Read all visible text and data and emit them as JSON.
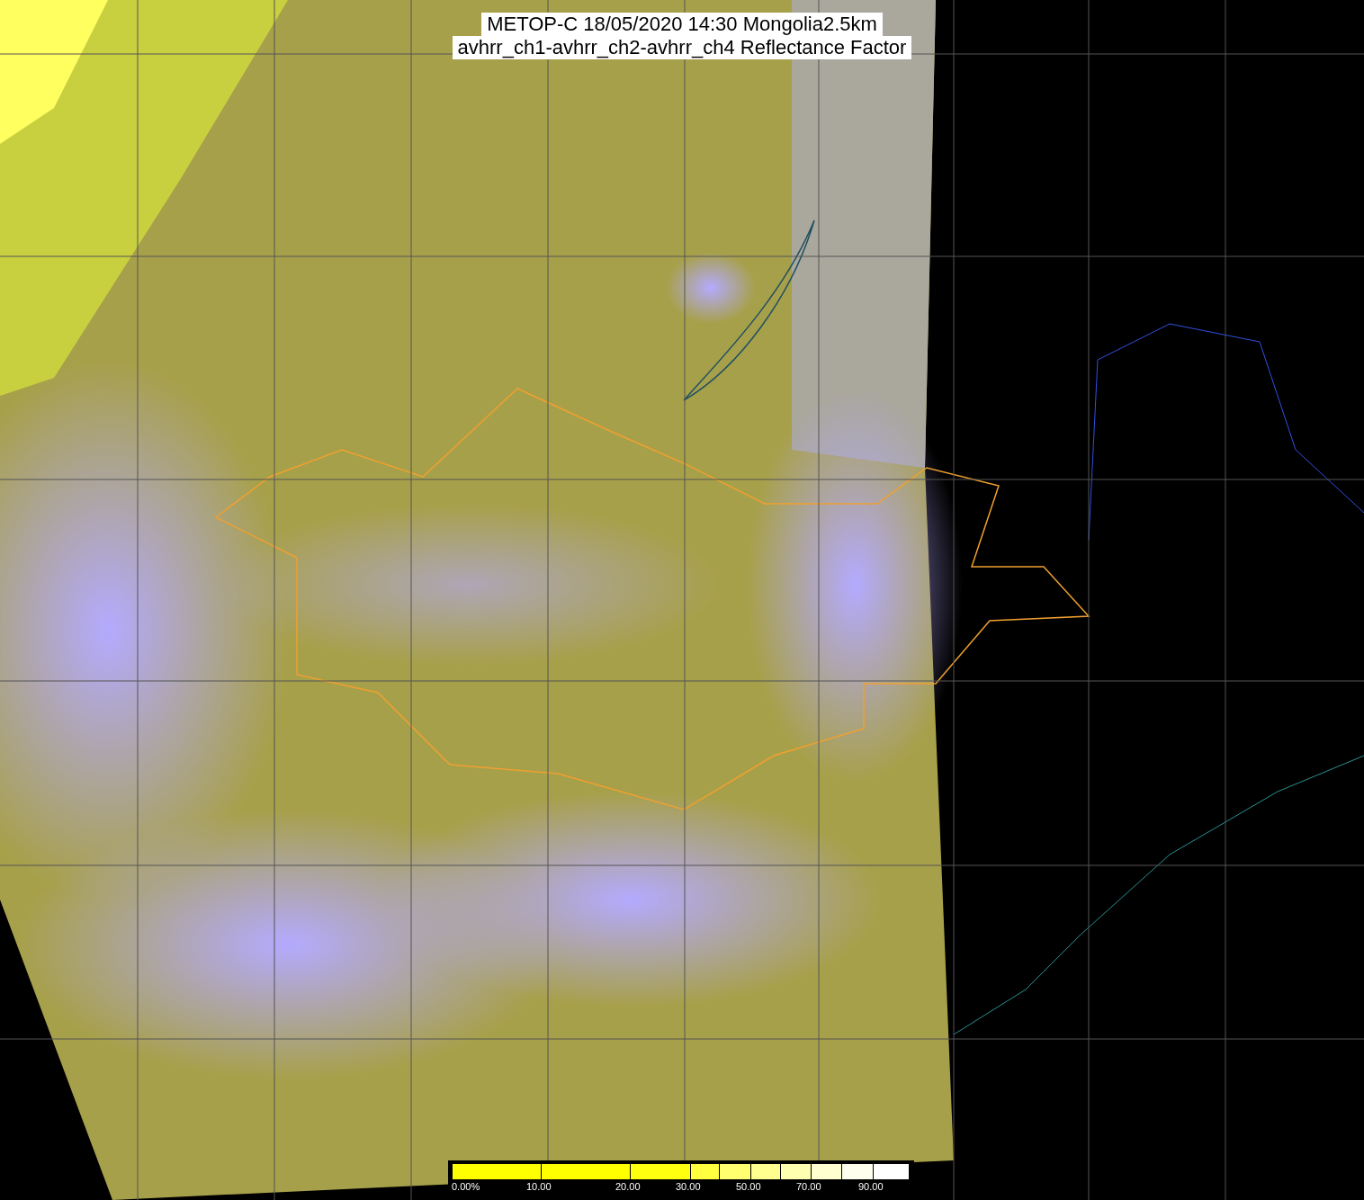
{
  "title_lines": [
    "METOP-C 18/05/2020 14:30 Mongolia2.5km",
    "avhrr_ch1-avhrr_ch2-avhrr_ch4 Reflectance Factor"
  ],
  "colorbar": {
    "segments": [
      {
        "color": "#ffff00",
        "label": "0.00%"
      },
      {
        "color": "#ffff00",
        "label": "10.00"
      },
      {
        "color": "#ffff10",
        "label": "20.00"
      },
      {
        "color": "#ffff40",
        "label": "30.00"
      },
      {
        "color": "#ffff70"
      },
      {
        "color": "#ffff90",
        "label": "50.00"
      },
      {
        "color": "#ffffb0"
      },
      {
        "color": "#ffffd0",
        "label": "70.00"
      },
      {
        "color": "#ffffee"
      },
      {
        "color": "#ffffff",
        "label": "90.00"
      }
    ]
  }
}
